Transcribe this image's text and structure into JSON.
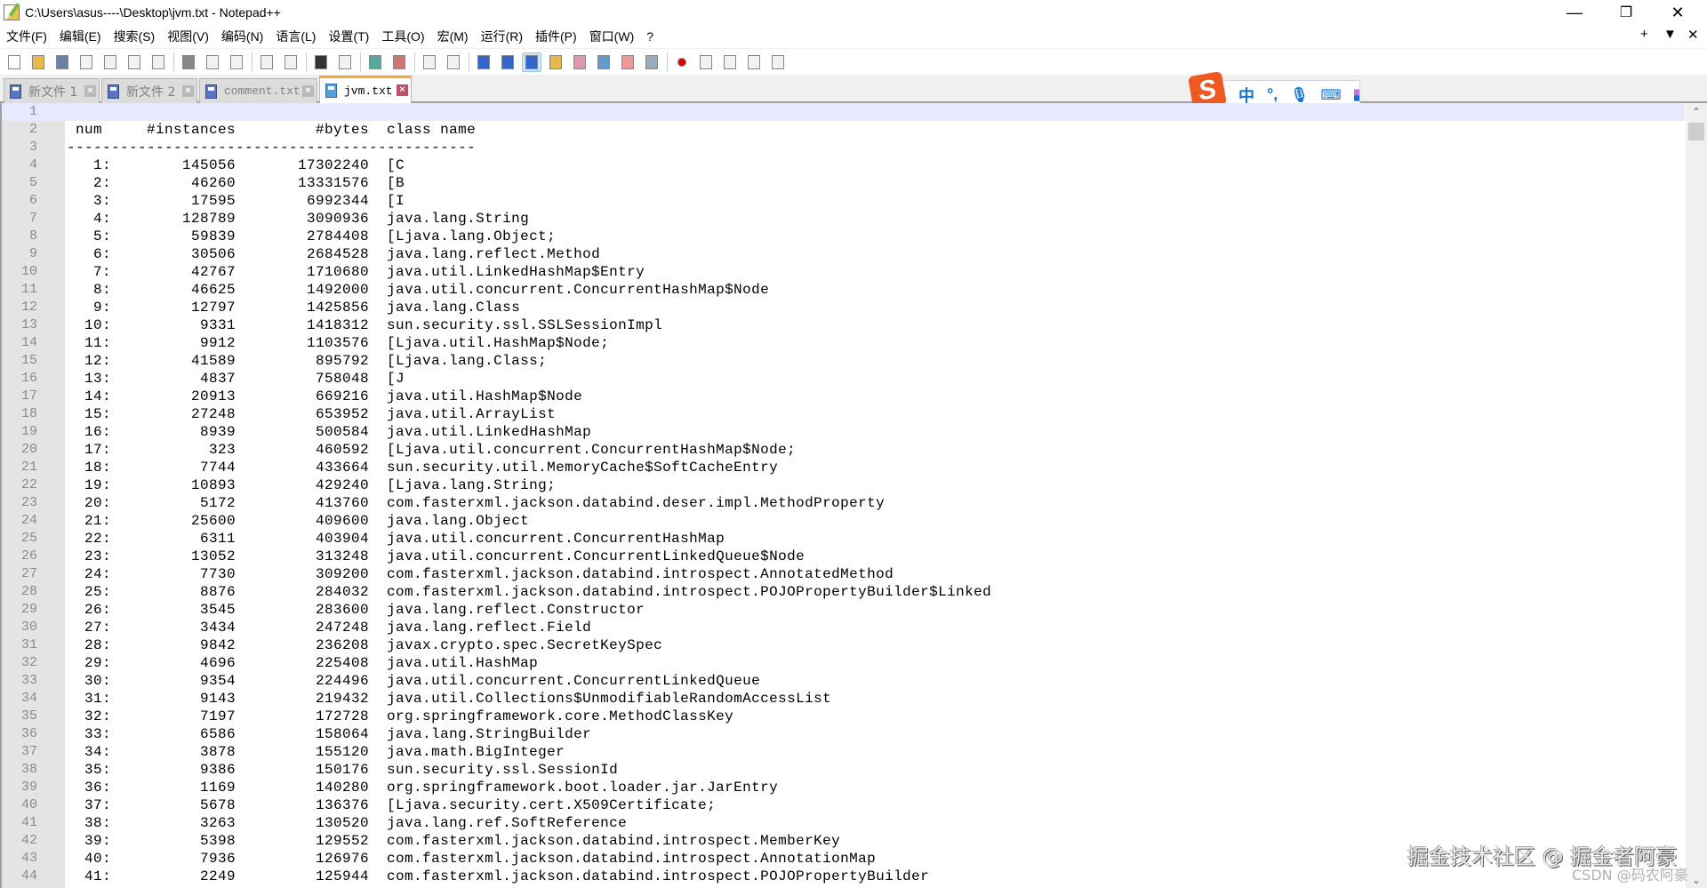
{
  "window": {
    "title": "C:\\Users\\asus----\\Desktop\\jvm.txt - Notepad++",
    "minimize": "—",
    "restore": "❐",
    "close": "✕"
  },
  "menu": [
    "文件(F)",
    "编辑(E)",
    "搜索(S)",
    "视图(V)",
    "编码(N)",
    "语言(L)",
    "设置(T)",
    "工具(O)",
    "宏(M)",
    "运行(R)",
    "插件(P)",
    "窗口(W)",
    "?"
  ],
  "doc_controls": {
    "add": "+",
    "list": "▼",
    "close": "✕"
  },
  "toolbar": [
    "new-file",
    "open-file",
    "save",
    "save-all",
    "close",
    "close-all",
    "print",
    "|",
    "cut",
    "copy",
    "paste",
    "|",
    "undo",
    "redo",
    "|",
    "find",
    "replace",
    "|",
    "zoom-in",
    "zoom-out",
    "|",
    "sync-vertical",
    "sync-horizontal",
    "|",
    "word-wrap",
    "show-all-chars",
    "indent-guide",
    "user-lang",
    "doc-map",
    "function-list",
    "folder-as-workspace",
    "monitor",
    "|",
    "record-macro",
    "stop-record",
    "play-macro",
    "run-macro-multiple",
    "save-macro"
  ],
  "tabs": [
    {
      "label": "新文件 1",
      "active": false,
      "cjk": true
    },
    {
      "label": "新文件 2",
      "active": false,
      "cjk": true
    },
    {
      "label": "comment.txt",
      "active": false,
      "cjk": false
    },
    {
      "label": "jvm.txt",
      "active": true,
      "cjk": false
    }
  ],
  "ime": {
    "logo": "S",
    "mode": "中",
    "punct": "°,",
    "voice": "mic-icon",
    "keyboard": "keyboard-icon",
    "tools": "toolbox-icon"
  },
  "editor": {
    "header": {
      "num": "num",
      "instances": "#instances",
      "bytes": "#bytes",
      "class": "class name"
    },
    "rows": [
      [
        1,
        145056,
        17302240,
        "[C"
      ],
      [
        2,
        46260,
        13331576,
        "[B"
      ],
      [
        3,
        17595,
        6992344,
        "[I"
      ],
      [
        4,
        128789,
        3090936,
        "java.lang.String"
      ],
      [
        5,
        59839,
        2784408,
        "[Ljava.lang.Object;"
      ],
      [
        6,
        30506,
        2684528,
        "java.lang.reflect.Method"
      ],
      [
        7,
        42767,
        1710680,
        "java.util.LinkedHashMap$Entry"
      ],
      [
        8,
        46625,
        1492000,
        "java.util.concurrent.ConcurrentHashMap$Node"
      ],
      [
        9,
        12797,
        1425856,
        "java.lang.Class"
      ],
      [
        10,
        9331,
        1418312,
        "sun.security.ssl.SSLSessionImpl"
      ],
      [
        11,
        9912,
        1103576,
        "[Ljava.util.HashMap$Node;"
      ],
      [
        12,
        41589,
        895792,
        "[Ljava.lang.Class;"
      ],
      [
        13,
        4837,
        758048,
        "[J"
      ],
      [
        14,
        20913,
        669216,
        "java.util.HashMap$Node"
      ],
      [
        15,
        27248,
        653952,
        "java.util.ArrayList"
      ],
      [
        16,
        8939,
        500584,
        "java.util.LinkedHashMap"
      ],
      [
        17,
        323,
        460592,
        "[Ljava.util.concurrent.ConcurrentHashMap$Node;"
      ],
      [
        18,
        7744,
        433664,
        "sun.security.util.MemoryCache$SoftCacheEntry"
      ],
      [
        19,
        10893,
        429240,
        "[Ljava.lang.String;"
      ],
      [
        20,
        5172,
        413760,
        "com.fasterxml.jackson.databind.deser.impl.MethodProperty"
      ],
      [
        21,
        25600,
        409600,
        "java.lang.Object"
      ],
      [
        22,
        6311,
        403904,
        "java.util.concurrent.ConcurrentHashMap"
      ],
      [
        23,
        13052,
        313248,
        "java.util.concurrent.ConcurrentLinkedQueue$Node"
      ],
      [
        24,
        7730,
        309200,
        "com.fasterxml.jackson.databind.introspect.AnnotatedMethod"
      ],
      [
        25,
        8876,
        284032,
        "com.fasterxml.jackson.databind.introspect.POJOPropertyBuilder$Linked"
      ],
      [
        26,
        3545,
        283600,
        "java.lang.reflect.Constructor"
      ],
      [
        27,
        3434,
        247248,
        "java.lang.reflect.Field"
      ],
      [
        28,
        9842,
        236208,
        "javax.crypto.spec.SecretKeySpec"
      ],
      [
        29,
        4696,
        225408,
        "java.util.HashMap"
      ],
      [
        30,
        9354,
        224496,
        "java.util.concurrent.ConcurrentLinkedQueue"
      ],
      [
        31,
        9143,
        219432,
        "java.util.Collections$UnmodifiableRandomAccessList"
      ],
      [
        32,
        7197,
        172728,
        "org.springframework.core.MethodClassKey"
      ],
      [
        33,
        6586,
        158064,
        "java.lang.StringBuilder"
      ],
      [
        34,
        3878,
        155120,
        "java.math.BigInteger"
      ],
      [
        35,
        9386,
        150176,
        "sun.security.ssl.SessionId"
      ],
      [
        36,
        1169,
        140280,
        "org.springframework.boot.loader.jar.JarEntry"
      ],
      [
        37,
        5678,
        136376,
        "[Ljava.security.cert.X509Certificate;"
      ],
      [
        38,
        3263,
        130520,
        "java.lang.ref.SoftReference"
      ],
      [
        39,
        5398,
        129552,
        "com.fasterxml.jackson.databind.introspect.MemberKey"
      ],
      [
        40,
        7936,
        126976,
        "com.fasterxml.jackson.databind.introspect.AnnotationMap"
      ],
      [
        41,
        2249,
        125944,
        "com.fasterxml.jackson.databind.introspect.POJOPropertyBuilder"
      ]
    ]
  },
  "scrollbar": {
    "up": "⌃",
    "down": "⌄"
  },
  "watermark": {
    "primary": "掘金技术社区 @ 掘金者阿豪",
    "secondary": "CSDN @码农阿豪"
  }
}
